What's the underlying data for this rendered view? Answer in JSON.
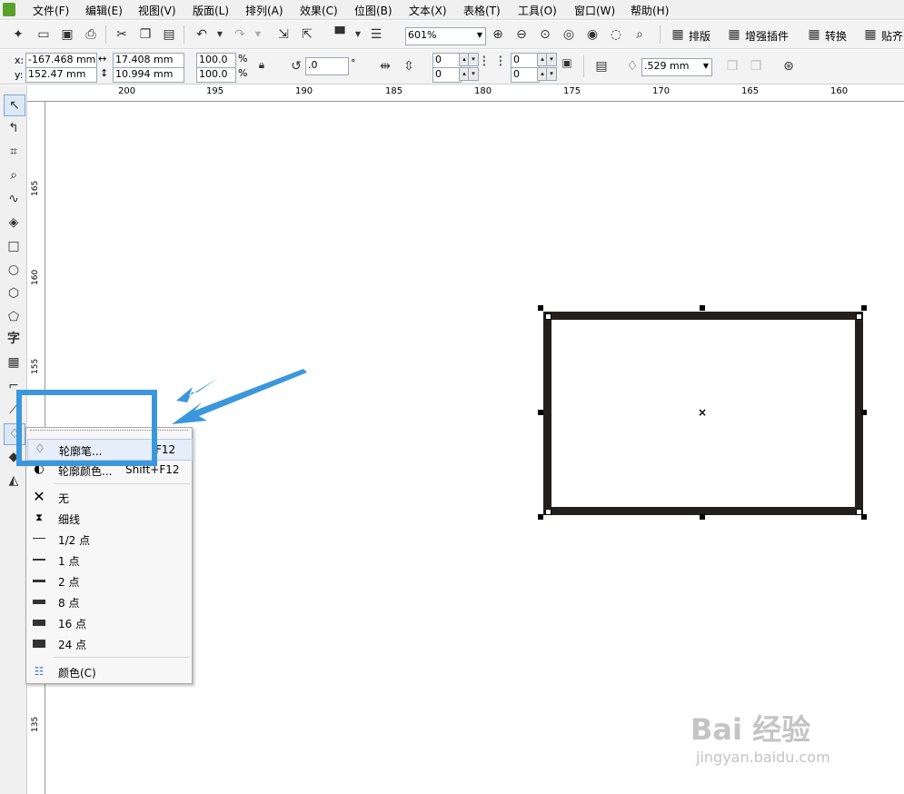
{
  "menubar": {
    "items": [
      "文件(F)",
      "编辑(E)",
      "视图(V)",
      "版面(L)",
      "排列(A)",
      "效果(C)",
      "位图(B)",
      "文本(X)",
      "表格(T)",
      "工具(O)",
      "窗口(W)",
      "帮助(H)"
    ]
  },
  "toolbar": {
    "zoom": "601%",
    "buttons": [
      "排版",
      "增强插件",
      "转换",
      "贴齐"
    ]
  },
  "propertybar": {
    "x": "-167.468 mm",
    "y": "152.47 mm",
    "width": "17.408 mm",
    "height": "10.994 mm",
    "scale_x": "100.0",
    "scale_y": "100.0",
    "percent": "%",
    "rotation": ".0",
    "degree": "°",
    "corner_a1": "0",
    "corner_a2": "0",
    "corner_b1": "0",
    "corner_b2": "0",
    "outline_width": ".529 mm",
    "x_label": "x:",
    "y_label": "y:"
  },
  "ruler": {
    "top_labels": [
      "200",
      "195",
      "190",
      "185",
      "180",
      "175",
      "170",
      "165",
      "160"
    ],
    "left_labels": [
      "165",
      "160",
      "155",
      "135"
    ]
  },
  "flyout": {
    "items": [
      {
        "label": "轮廓笔...",
        "shortcut": "F12",
        "icon": "pen-nib-icon"
      },
      {
        "label": "轮廓颜色...",
        "shortcut": "Shift+F12",
        "icon": "outline-color-icon"
      },
      {
        "label": "无",
        "icon": "none-x-icon"
      },
      {
        "label": "细线",
        "icon": "hairline-icon"
      },
      {
        "label": "1/2 点",
        "icon": "line-half-icon"
      },
      {
        "label": "1 点",
        "icon": "line-1-icon"
      },
      {
        "label": "2 点",
        "icon": "line-2-icon"
      },
      {
        "label": "8 点",
        "icon": "line-8-icon"
      },
      {
        "label": "16 点",
        "icon": "line-16-icon"
      },
      {
        "label": "24 点",
        "icon": "line-24-icon"
      },
      {
        "label": "颜色(C)",
        "icon": "color-palette-icon"
      }
    ]
  },
  "watermark": {
    "text": "Bai 经验",
    "url": "jingyan.baidu.com"
  },
  "colors": {
    "accent_annotation": "#3b97dc",
    "shape_outline": "#231f1c"
  }
}
